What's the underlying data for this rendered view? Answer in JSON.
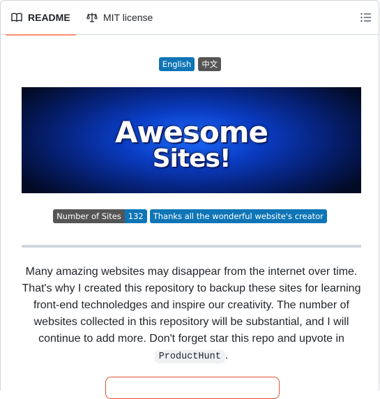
{
  "tabs": {
    "readme_label": "README",
    "license_label": "MIT license"
  },
  "languages": {
    "english": "English",
    "chinese": "中文"
  },
  "banner": {
    "line1": "Awesome",
    "line2": "Sites!"
  },
  "shields": {
    "sites_label": "Number of Sites",
    "sites_count": "132",
    "thanks": "Thanks all the wonderful website's creator"
  },
  "intro": {
    "text": "Many amazing websites may disappear from the internet over time. That's why I created this repository to backup these sites for learning front-end technoledges and inspire our creativity. The number of websites collected in this repository will be substantial, and I will continue to add more. Don't forget star this repo and upvote in ",
    "code": "ProductHunt",
    "end": "."
  },
  "colors": {
    "tab_underline": "#fd8c73",
    "badge_blue": "#0e75b6",
    "badge_gray": "#555555",
    "producthunt": "#da552f"
  }
}
